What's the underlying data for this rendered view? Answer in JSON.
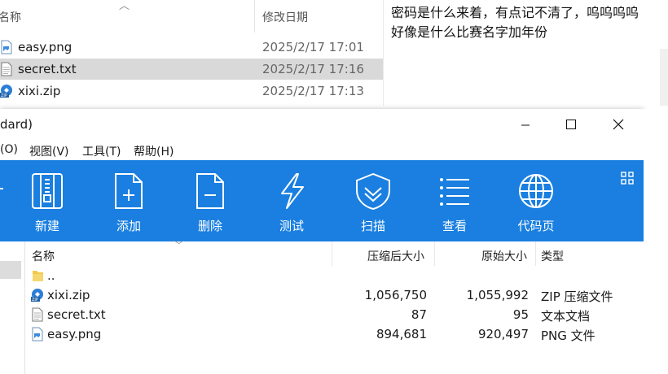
{
  "explorer": {
    "col_name": "名称",
    "col_date": "修改日期",
    "files": [
      {
        "name": "easy.png",
        "date": "2025/2/17 17:01",
        "icon": "png-file-icon",
        "selected": false
      },
      {
        "name": "secret.txt",
        "date": "2025/2/17 17:16",
        "icon": "txt-file-icon",
        "selected": true
      },
      {
        "name": "xixi.zip",
        "date": "2025/2/17 17:13",
        "icon": "zip-file-icon",
        "selected": false
      }
    ]
  },
  "notepad": {
    "line1": "密码是什么来着，有点记不清了，呜呜呜呜",
    "line2": "好像是什么比赛名字加年份"
  },
  "archive": {
    "title": "dard)",
    "menu": [
      "(O)",
      "视图(V)",
      "工具(T)",
      "帮助(H)"
    ],
    "toolbar": [
      {
        "label": "新建",
        "icon": "new-archive-icon"
      },
      {
        "label": "添加",
        "icon": "add-file-icon"
      },
      {
        "label": "删除",
        "icon": "delete-file-icon"
      },
      {
        "label": "测试",
        "icon": "test-lightning-icon"
      },
      {
        "label": "扫描",
        "icon": "scan-shield-icon"
      },
      {
        "label": "查看",
        "icon": "view-list-icon"
      },
      {
        "label": "代码页",
        "icon": "codepage-globe-icon"
      }
    ],
    "columns": {
      "name": "名称",
      "compressed": "压缩后大小",
      "original": "原始大小",
      "type": "类型"
    },
    "rows": [
      {
        "name": "..",
        "compressed": "",
        "original": "",
        "type": "",
        "icon": "folder-icon"
      },
      {
        "name": "xixi.zip",
        "compressed": "1,056,750",
        "original": "1,055,992",
        "type": "ZIP 压缩文件",
        "icon": "zip-file-icon"
      },
      {
        "name": "secret.txt",
        "compressed": "87",
        "original": "95",
        "type": "文本文档",
        "icon": "txt-file-icon"
      },
      {
        "name": "easy.png",
        "compressed": "894,681",
        "original": "920,497",
        "type": "PNG 文件",
        "icon": "png-file-icon"
      }
    ]
  },
  "colors": {
    "toolbar_blue": "#1a7fe0",
    "selection_gray": "#d9d9d9"
  }
}
